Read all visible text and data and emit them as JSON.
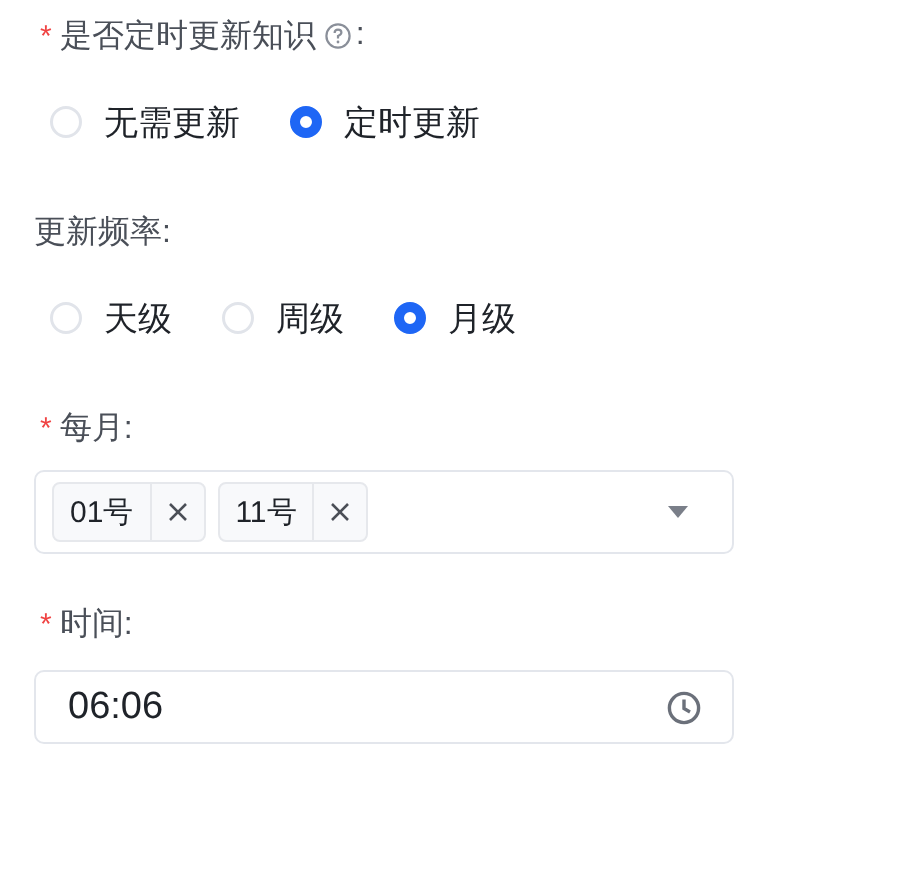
{
  "fields": [
    {
      "kind": "radio",
      "required_mark": "*",
      "label": "是否定时更新知识",
      "help": true,
      "label_suffix": ":",
      "options": [
        {
          "label": "无需更新",
          "selected": false
        },
        {
          "label": "定时更新",
          "selected": true
        }
      ]
    },
    {
      "kind": "radio",
      "label": "更新频率:",
      "options": [
        {
          "label": "天级",
          "selected": false
        },
        {
          "label": "周级",
          "selected": false
        },
        {
          "label": "月级",
          "selected": true
        }
      ]
    },
    {
      "kind": "select",
      "required_mark": "*",
      "label": "每月:",
      "tags": [
        "01号",
        "11号"
      ]
    },
    {
      "kind": "time",
      "required_mark": "*",
      "label": "时间:",
      "value": "06:06"
    }
  ]
}
